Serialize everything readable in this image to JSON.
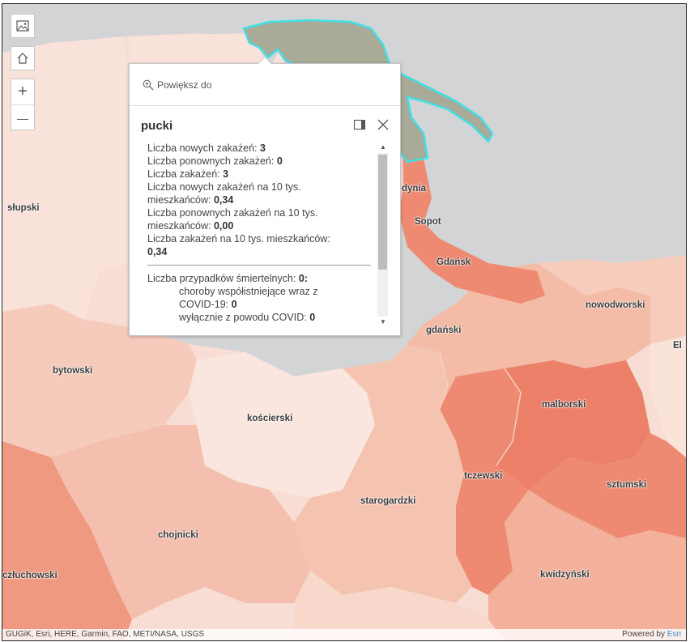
{
  "controls": {
    "basemap_icon": "image-icon",
    "home_icon": "home-icon",
    "zoom_in": "+",
    "zoom_out": "—"
  },
  "map_labels": {
    "slupski": "słupski",
    "bytowski": "bytowski",
    "koscierski": "kościerski",
    "chojnicki": "chojnicki",
    "czluchowski": "człuchowski",
    "starogardzki": "starogardzki",
    "tczewski": "tczewski",
    "malborski": "malborski",
    "sztumski": "sztumski",
    "kwidzynski": "kwidzyński",
    "gdanski": "gdański",
    "nowodworski": "nowodworski",
    "gdansk": "Gdańsk",
    "sopot": "Sopot",
    "gdynia": "dynia",
    "elblag": "El"
  },
  "popup": {
    "zoom_to": "Powiększ do",
    "title": "pucki",
    "lines": {
      "new_label": "Liczba nowych zakażeń: ",
      "new_value": "3",
      "re_label": "Liczba ponownych zakażeń: ",
      "re_value": "0",
      "total_label": "Liczba zakażeń: ",
      "total_value": "3",
      "new10k_label_a": "Liczba nowych zakażeń na 10 tys.",
      "new10k_label_b": "mieszkańców: ",
      "new10k_value": "0,34",
      "re10k_label_a": "Liczba ponownych zakażeń na 10 tys.",
      "re10k_label_b": "mieszkańców: ",
      "re10k_value": "0,00",
      "total10k_label": "Liczba zakażeń na 10 tys. mieszkańców:",
      "total10k_value": "0,34",
      "deaths_label": "Liczba przypadków śmiertelnych: ",
      "deaths_value": "0:",
      "comorb_label_a": "choroby współistniejące wraz z",
      "comorb_label_b": "COVID-19: ",
      "comorb_value": "0",
      "only_covid_label": "wyłącznie z powodu COVID: ",
      "only_covid_value": "0"
    }
  },
  "attribution": {
    "sources": "GUGiK, Esri, HERE, Garmin, FAO, METI/NASA, USGS",
    "powered_by": "Powered by ",
    "esri": "Esri"
  },
  "colors": {
    "sea": "#d2d4d6",
    "selected": "#a9aa98",
    "highlight": "#3fe0e6",
    "light": "#f7ddd3",
    "pale": "#f9e2da",
    "mid": "#f4bba6",
    "strong": "#ef8a72",
    "darker": "#eb7e68"
  }
}
